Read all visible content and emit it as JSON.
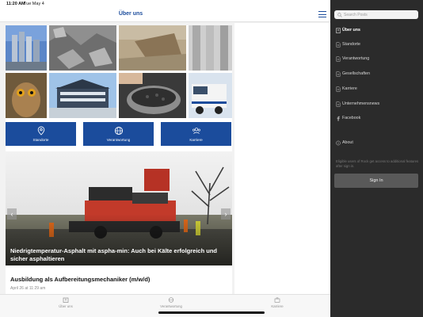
{
  "status_bar": {
    "time": "11:20 AM",
    "date": "Tue May 4"
  },
  "header": {
    "title": "Über uns"
  },
  "quick_links": [
    {
      "label": "Standorte",
      "icon": "location-pin-icon"
    },
    {
      "label": "Verantwortung",
      "icon": "globe-icon"
    },
    {
      "label": "Karriere",
      "icon": "people-icon"
    }
  ],
  "hero": {
    "caption": "Niedrigtemperatur-Asphalt mit aspha-min: Auch bei Kälte erfolgreich und sicher asphaltieren"
  },
  "article": {
    "title": "Ausbildung als Aufbereitungsmechaniker (m/w/d)",
    "date": "April 26 at 11:29 am"
  },
  "tabbar": [
    {
      "label": "Über uns",
      "icon": "building-icon"
    },
    {
      "label": "Verantwortung",
      "icon": "globe-icon"
    },
    {
      "label": "Karriere",
      "icon": "briefcase-icon"
    }
  ],
  "sidebar": {
    "search_placeholder": "Search Posts",
    "items": [
      {
        "label": "Über uns",
        "icon": "building-icon",
        "active": true
      },
      {
        "label": "Standorte",
        "icon": "document-icon"
      },
      {
        "label": "Verantwortung",
        "icon": "document-icon"
      },
      {
        "label": "Gesellschaften",
        "icon": "document-icon"
      },
      {
        "label": "Karriere",
        "icon": "document-icon"
      },
      {
        "label": "Unternehmensnews",
        "icon": "document-icon"
      },
      {
        "label": "Facebook",
        "icon": "facebook-icon"
      },
      {
        "label": "About",
        "icon": "info-icon"
      }
    ],
    "note": "Eligible users of Rock get access to additional features after sign in.",
    "sign_in_label": "Sign In"
  },
  "colors": {
    "brand_blue": "#1b4c9c",
    "sidebar_bg": "#2b2b2b",
    "button_gray": "#595959"
  }
}
